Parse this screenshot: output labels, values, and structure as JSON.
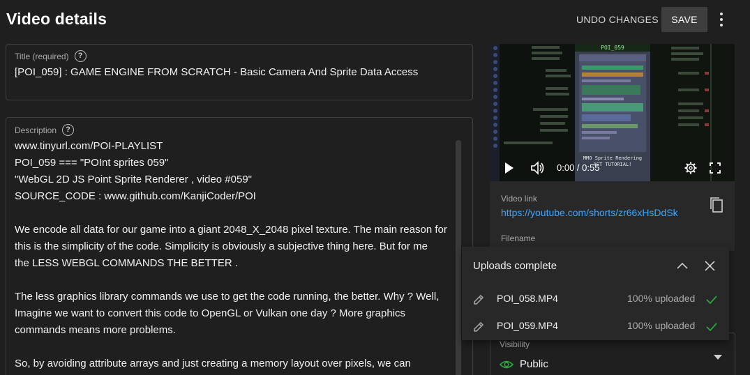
{
  "header": {
    "title": "Video details",
    "undo_label": "UNDO CHANGES",
    "save_label": "SAVE"
  },
  "title_field": {
    "label": "Title (required)",
    "value": "[POI_059] : GAME ENGINE FROM SCRATCH - Basic Camera And Sprite Data Access"
  },
  "description_field": {
    "label": "Description",
    "lines": [
      "www.tinyurl.com/POI-PLAYLIST",
      "POI_059 === \"POInt sprites 059\"",
      "\"WebGL 2D JS Point Sprite Renderer , video #059\"",
      "SOURCE_CODE : www.github.com/KanjiCoder/POI",
      "",
      "We encode all data for our game into a giant 2048_X_2048 pixel texture. The main reason for",
      "this is the simplicity of the code. Simplicity is obviously a subjective thing here. But for me",
      "the LESS WEBGL COMMANDS THE BETTER .",
      "",
      "The less graphics library commands we use to get the code running, the better. Why ? Well,",
      "Imagine we want to convert this code to OpenGL or Vulkan one day ? More graphics",
      "commands means more problems.",
      "",
      "So, by avoiding attribute arrays and just creating a memory layout over pixels, we can"
    ]
  },
  "video": {
    "time": "0:00 / 0:55",
    "overlay_title": "POI_059",
    "overlay_caption_1": "MMO Sprite Rendering",
    "overlay_caption_2": "AST TUTORIAL!"
  },
  "video_info": {
    "link_label": "Video link",
    "link_url": "https://youtube.com/shorts/zr66xHsDdSk",
    "filename_label": "Filename"
  },
  "uploads": {
    "title": "Uploads complete",
    "items": [
      {
        "name": "POI_058.MP4",
        "status": "100% uploaded"
      },
      {
        "name": "POI_059.MP4",
        "status": "100% uploaded"
      }
    ]
  },
  "visibility": {
    "label": "Visibility",
    "value": "Public"
  },
  "colors": {
    "background": "#1f1f1f",
    "link": "#3ea6ff",
    "success": "#2ba640"
  },
  "icons": [
    "help-icon",
    "play-icon",
    "volume-icon",
    "settings-icon",
    "fullscreen-icon",
    "copy-icon",
    "chevron-up-icon",
    "close-icon",
    "pencil-icon",
    "check-icon",
    "eye-icon",
    "dropdown-arrow-icon",
    "more-vert-icon"
  ]
}
